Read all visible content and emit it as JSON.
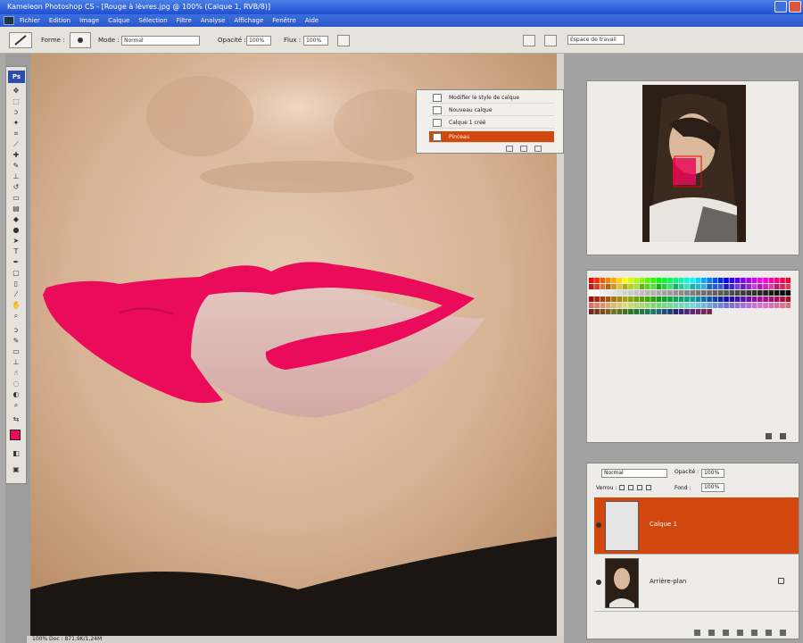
{
  "window": {
    "title": "Kameleon Photoshop CS - [Rouge à lèvres.jpg @ 100% (Calque 1, RVB/8)]"
  },
  "menu": [
    "Fichier",
    "Edition",
    "Image",
    "Calque",
    "Sélection",
    "Filtre",
    "Analyse",
    "Affichage",
    "Fenêtre",
    "Aide"
  ],
  "options": {
    "brush_label": "Forme :",
    "mode_label": "Mode :",
    "mode_value": "Normal",
    "opacity_label": "Opacité :",
    "opacity_value": "100%",
    "flow_label": "Flux :",
    "flow_value": "100%",
    "workspace_value": "Espace de travail"
  },
  "history": {
    "items": [
      {
        "label": "Modifier le style de calque"
      },
      {
        "label": "Nouveau calque"
      },
      {
        "label": "Calque 1 créé"
      },
      {
        "label": "Pinceau"
      }
    ]
  },
  "status": {
    "text": "100%   Doc : 871,9K/1,24M"
  },
  "layers": {
    "blend_mode": "Normal",
    "opacity_label": "Opacité :",
    "opacity_value": "100%",
    "lock_label": "Verrou :",
    "fill_label": "Fond :",
    "fill_value": "100%",
    "items": [
      {
        "name": "Calque 1",
        "active": true
      },
      {
        "name": "Arrière-plan",
        "active": false
      }
    ]
  },
  "colors": {
    "accent": "#d2470e",
    "lipstick": "#ea0b5a",
    "foreground": "#ea0b5a"
  }
}
